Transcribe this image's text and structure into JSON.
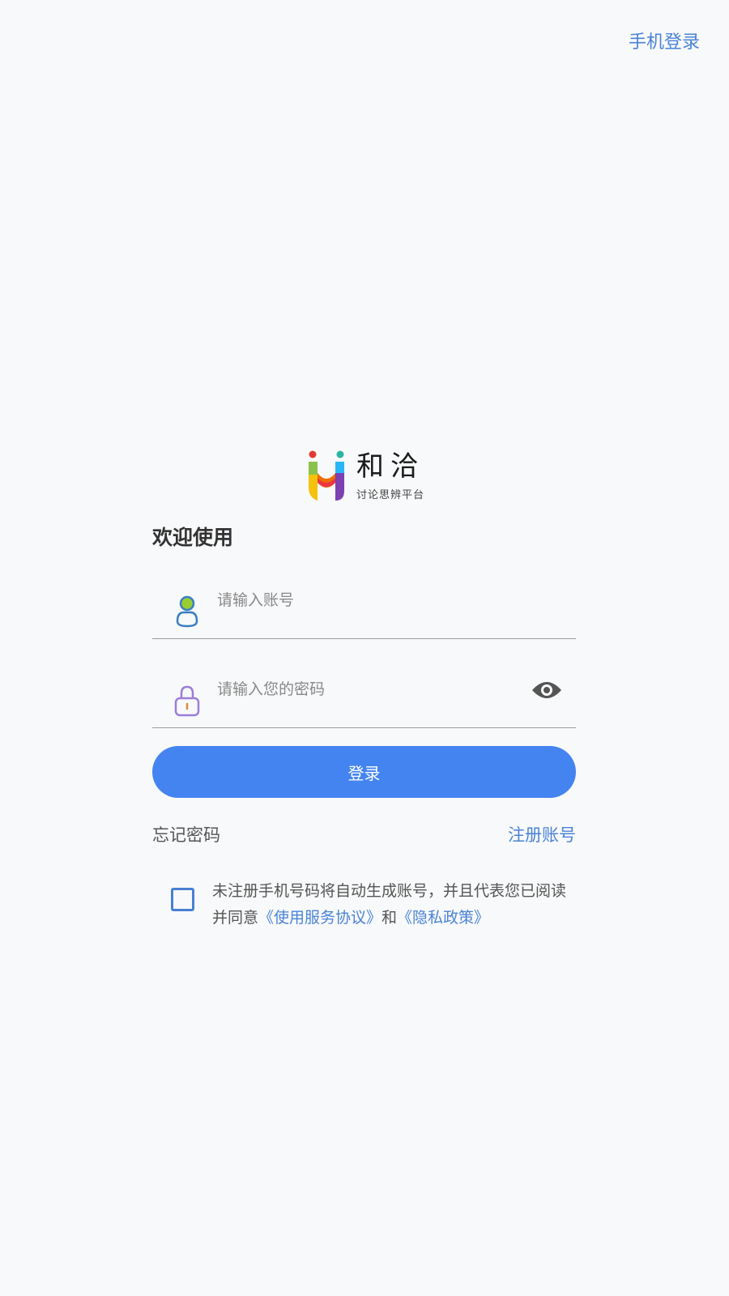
{
  "header": {
    "phone_login_label": "手机登录"
  },
  "logo": {
    "title": "和洽",
    "subtitle": "讨论思辨平台"
  },
  "welcome": "欢迎使用",
  "form": {
    "account_placeholder": "请输入账号",
    "password_placeholder": "请输入您的密码",
    "account_icon": "user-icon",
    "password_icon": "lock-icon",
    "visibility_icon": "eye-icon",
    "login_label": "登录"
  },
  "links": {
    "forgot_password": "忘记密码",
    "register": "注册账号"
  },
  "agreement": {
    "checked": false,
    "text_before": "未注册手机号码将自动生成账号，并且代表您已阅读并同意",
    "terms_link": "《使用服务协议》",
    "conjunction": "和",
    "privacy_link": "《隐私政策》"
  },
  "colors": {
    "background": "#f8f9fa",
    "primary_button": "#4484f0",
    "link": "#4a83d6",
    "checkbox_border": "#4a7fd3"
  }
}
